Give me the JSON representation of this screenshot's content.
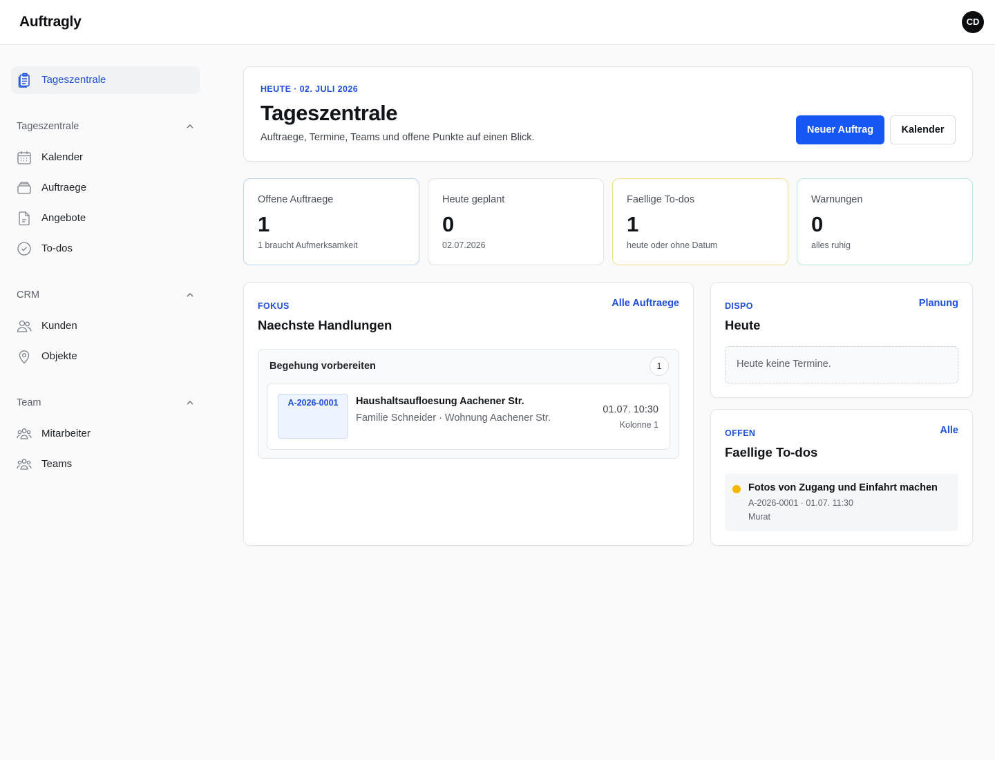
{
  "app": {
    "brand": "Auftragly",
    "user_initials": "CD"
  },
  "colors": {
    "accent": "#1558f5",
    "link": "#1d4ed8",
    "todo_dot": "#f5b700"
  },
  "sidebar": {
    "active": {
      "label": "Tageszentrale",
      "icon": "clipboard-icon"
    },
    "groups": [
      {
        "label": "Tageszentrale",
        "items": [
          {
            "label": "Kalender",
            "icon": "calendar-icon"
          },
          {
            "label": "Auftraege",
            "icon": "stack-icon"
          },
          {
            "label": "Angebote",
            "icon": "document-icon"
          },
          {
            "label": "To-dos",
            "icon": "check-circle-icon"
          }
        ]
      },
      {
        "label": "CRM",
        "items": [
          {
            "label": "Kunden",
            "icon": "users-icon"
          },
          {
            "label": "Objekte",
            "icon": "map-pin-icon"
          }
        ]
      },
      {
        "label": "Team",
        "items": [
          {
            "label": "Mitarbeiter",
            "icon": "people-group-icon"
          },
          {
            "label": "Teams",
            "icon": "people-group-icon"
          }
        ]
      }
    ]
  },
  "hero": {
    "eyebrow": "HEUTE · 02. JULI 2026",
    "title": "Tageszentrale",
    "subtitle": "Auftraege, Termine, Teams und offene Punkte auf einen Blick.",
    "primary_button": "Neuer Auftrag",
    "secondary_button": "Kalender"
  },
  "stats": [
    {
      "title": "Offene Auftraege",
      "value": "1",
      "sub": "1 braucht Aufmerksamkeit",
      "border": "#bcd3f7"
    },
    {
      "title": "Heute geplant",
      "value": "0",
      "sub": "02.07.2026",
      "border": "#dfe2e6"
    },
    {
      "title": "Faellige To-dos",
      "value": "1",
      "sub": "heute oder ohne Datum",
      "border": "#f3dc8a"
    },
    {
      "title": "Warnungen",
      "value": "0",
      "sub": "alles ruhig",
      "border": "#b9e8dc"
    }
  ],
  "focus": {
    "eyebrow": "FOKUS",
    "link": "Alle Auftraege",
    "title": "Naechste Handlungen",
    "group_title": "Begehung vorbereiten",
    "group_count": "1",
    "order": {
      "id": "A-2026-0001",
      "title": "Haushaltsaufloesung Aachener Str.",
      "subtitle": "Familie Schneider · Wohnung Aachener Str.",
      "time": "01.07. 10:30",
      "team": "Kolonne 1"
    }
  },
  "dispo": {
    "eyebrow": "DISPO",
    "link": "Planung",
    "title": "Heute",
    "empty": "Heute keine Termine."
  },
  "open_todos": {
    "eyebrow": "OFFEN",
    "link": "Alle",
    "title": "Faellige To-dos",
    "item": {
      "title": "Fotos von Zugang und Einfahrt machen",
      "meta": "A-2026-0001 · 01.07. 11:30",
      "assignee": "Murat"
    }
  }
}
